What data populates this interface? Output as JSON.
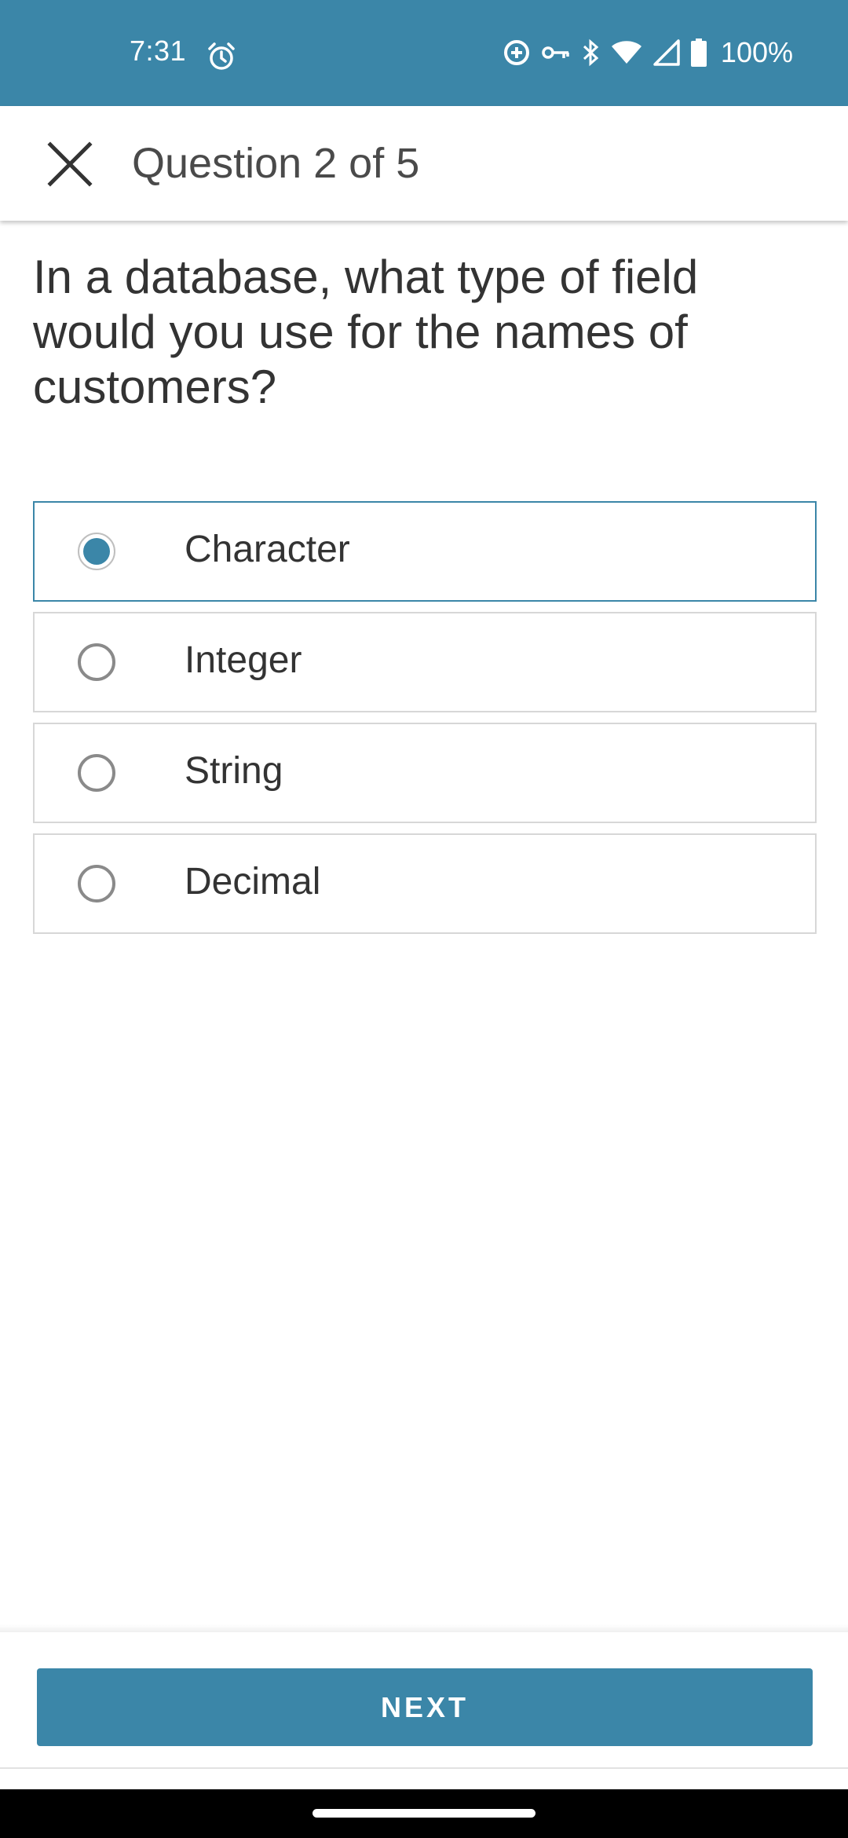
{
  "status_bar": {
    "time": "7:31",
    "battery": "100%",
    "icons": [
      "alarm-icon",
      "data-saver-icon",
      "vpn-key-icon",
      "bluetooth-icon",
      "wifi-icon",
      "cell-signal-icon",
      "battery-icon"
    ]
  },
  "app_bar": {
    "title": "Question 2 of 5",
    "close_icon": "close-icon"
  },
  "question": {
    "text": "In a database, what type of field would you use for the names of customers?"
  },
  "options": [
    {
      "label": "Character",
      "selected": true
    },
    {
      "label": "Integer",
      "selected": false
    },
    {
      "label": "String",
      "selected": false
    },
    {
      "label": "Decimal",
      "selected": false
    }
  ],
  "footer": {
    "next_label": "NEXT"
  },
  "colors": {
    "accent": "#3b86a8",
    "text": "#333333",
    "border": "#d7d7d7"
  }
}
